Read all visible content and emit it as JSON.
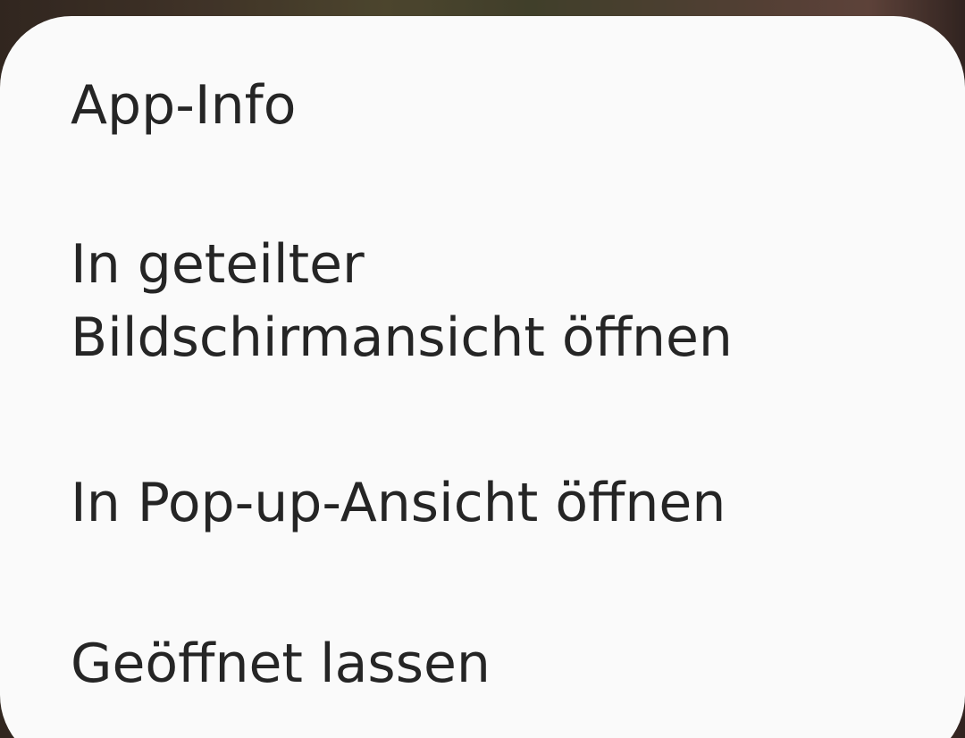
{
  "context_menu": {
    "items": [
      {
        "label": "App-Info"
      },
      {
        "label_line1": "In geteilter",
        "label_line2": "Bildschirmansicht öffnen"
      },
      {
        "label": "In Pop-up-Ansicht öffnen"
      },
      {
        "label": "Geöffnet lassen"
      }
    ]
  },
  "colors": {
    "menu_background": "#fafafa",
    "text": "#252525"
  }
}
